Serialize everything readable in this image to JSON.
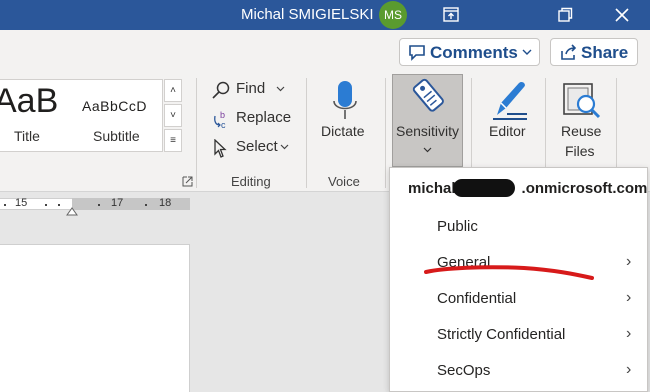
{
  "titlebar": {
    "user_name": "Michal SMIGIELSKI",
    "avatar_initials": "MS",
    "bg_color": "#2b579a",
    "icons": [
      "restore-ribbon-icon",
      "window-restore-icon",
      "close-icon"
    ]
  },
  "header_actions": {
    "comments_label": "Comments",
    "share_label": "Share"
  },
  "styles": {
    "normal_preview": "AaB",
    "subtitle_preview": "AaBbCcD",
    "title_label": "Title",
    "subtitle_label": "Subtitle"
  },
  "editing": {
    "find_label": "Find",
    "replace_label": "Replace",
    "select_label": "Select",
    "group_label": "Editing"
  },
  "voice": {
    "dictate_label": "Dictate",
    "group_label": "Voice"
  },
  "sensitivity": {
    "button_label": "Sensitivity",
    "editor_label": "Editor",
    "reuse_label_line1": "Reuse",
    "reuse_label_line2": "Files"
  },
  "ruler": {
    "labels": [
      "15",
      "17",
      "18"
    ]
  },
  "sensitivity_menu": {
    "account_prefix": "michal",
    "account_suffix": ".onmicrosoft.com",
    "items": [
      {
        "label": "Public",
        "has_submenu": false
      },
      {
        "label": "General",
        "has_submenu": true
      },
      {
        "label": "Confidential",
        "has_submenu": true
      },
      {
        "label": "Strictly Confidential",
        "has_submenu": true
      },
      {
        "label": "SecOps",
        "has_submenu": true
      }
    ],
    "annotation_color": "#d71a1a"
  }
}
